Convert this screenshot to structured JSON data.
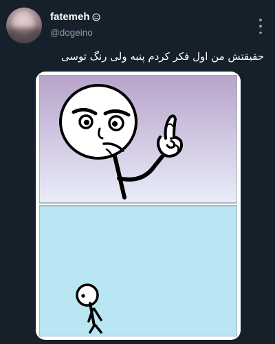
{
  "tweet": {
    "author_name": "fatemeh",
    "author_handle": "@dogeino",
    "text": "حقیقتش من اول فکر کردم پنبه ولی رنگ توسی",
    "name_emoji": "smiley-emoji-icon",
    "menu_icon": "more-vertical-icon",
    "media": "meme-comic-image",
    "colors": {
      "background": "#15202b",
      "text_primary": "#ffffff",
      "text_secondary": "#8b98a5",
      "panel_top_gradient_start": "#b8a3cb",
      "panel_top_gradient_end": "#e9edf8",
      "panel_bottom": "#b8e6f2"
    }
  }
}
